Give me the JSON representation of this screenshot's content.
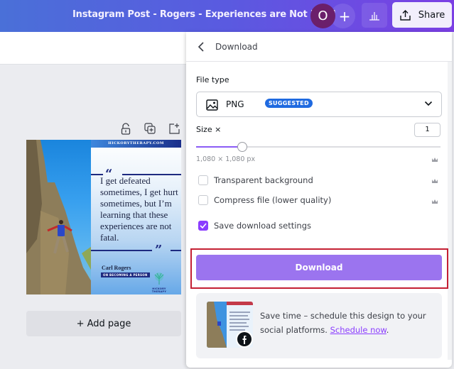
{
  "header": {
    "doc_title": "Instagram Post - Rogers - Experiences are Not Fatal",
    "avatar_initial": "O",
    "add_collaborator_icon": "+",
    "share_label": "Share"
  },
  "canvas": {
    "design": {
      "site_label": "HICKORYTHERAPY.COM",
      "open_quote": "“",
      "close_quote": "”",
      "quote": "I get defeated sometimes, I get hurt sometimes, but I’m learning that these experiences are not fatal.",
      "author": "Carl Rogers",
      "book": "ON BECOMING A PERSON",
      "brand": "HICKORY THERAPY"
    },
    "add_page_label": "+ Add page"
  },
  "download_panel": {
    "title": "Download",
    "file_type_label": "File type",
    "file_type_value": "PNG",
    "suggested_badge": "SUGGESTED",
    "size_label": "Size ×",
    "size_value": "1",
    "size_slider_fraction": 0.19,
    "dimensions": "1,080 × 1,080 px",
    "options": [
      {
        "label": "Transparent background",
        "checked": false,
        "premium": true
      },
      {
        "label": "Compress file (lower quality)",
        "checked": false,
        "premium": true
      },
      {
        "label": "Save download settings",
        "checked": true,
        "premium": false
      }
    ],
    "download_button": "Download",
    "promo": {
      "text": "Save time – schedule this design to your social platforms. ",
      "link": "Schedule now",
      "link_suffix": "."
    }
  },
  "colors": {
    "accent": "#8b3dff",
    "download_button": "#9b74ef",
    "badge": "#1f6ae0",
    "highlight": "#c42034"
  }
}
